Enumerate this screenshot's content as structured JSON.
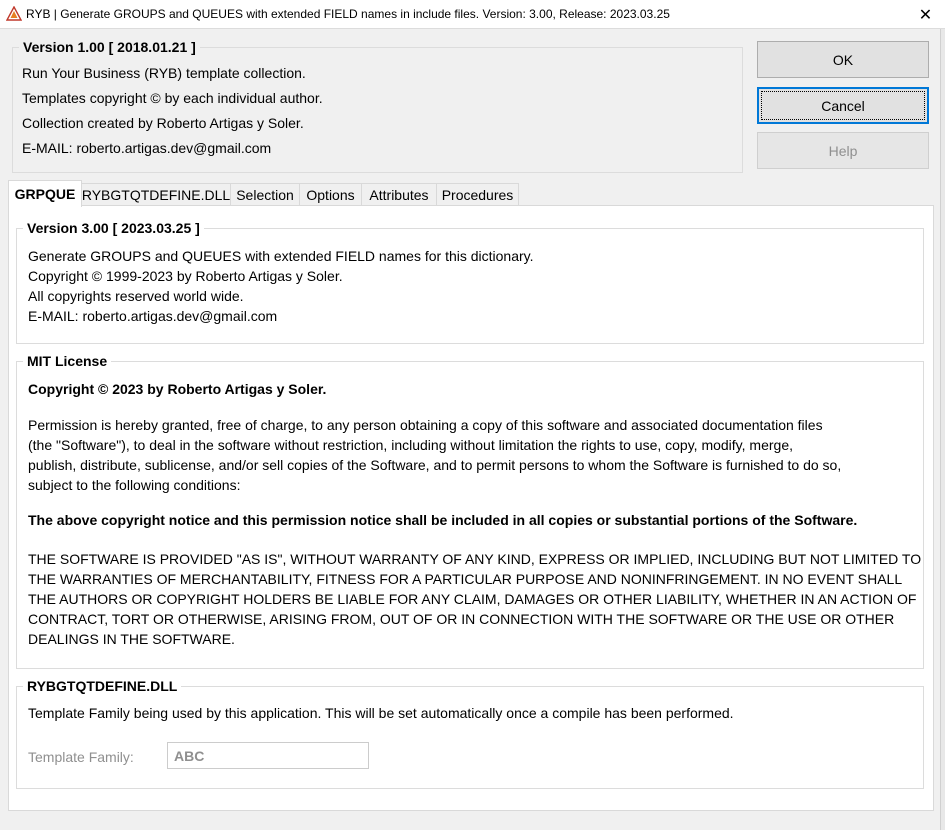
{
  "window": {
    "title": "RYB | Generate GROUPS and QUEUES with extended FIELD names in include files. Version: 3.00, Release: 2023.03.25",
    "icon": "warning-triangle-icon",
    "close_glyph": "✕"
  },
  "header": {
    "group_title": "Version 1.00 [ 2018.01.21 ]",
    "lines": [
      "Run Your Business (RYB) template collection.",
      "Templates copyright © by each individual author.",
      "Collection created by Roberto Artigas y Soler.",
      "E-MAIL: roberto.artigas.dev@gmail.com"
    ]
  },
  "buttons": {
    "ok": "OK",
    "cancel": "Cancel",
    "help": "Help"
  },
  "tabs": [
    {
      "label": "GRPQUE",
      "active": true
    },
    {
      "label": "RYBGTQTDEFINE.DLL",
      "active": false
    },
    {
      "label": "Selection",
      "active": false
    },
    {
      "label": "Options",
      "active": false
    },
    {
      "label": "Attributes",
      "active": false
    },
    {
      "label": "Procedures",
      "active": false
    }
  ],
  "version_group": {
    "title": "Version 3.00 [ 2023.03.25 ]",
    "lines": [
      "Generate GROUPS and QUEUES with extended FIELD names for this dictionary.",
      "Copyright © 1999-2023 by Roberto Artigas y Soler.",
      "All copyrights reserved world wide.",
      "E-MAIL: roberto.artigas.dev@gmail.com"
    ]
  },
  "license_group": {
    "title": "MIT License",
    "copyright": "Copyright © 2023 by Roberto Artigas y Soler.",
    "permission_lines": [
      "Permission is hereby granted, free of charge, to any person obtaining a copy of this software and associated documentation files",
      "(the \"Software\"), to deal in the software without restriction, including without limitation the rights to use, copy, modify, merge,",
      "publish, distribute, sublicense, and/or sell copies of the Software, and to permit persons to whom the Software is furnished to do so,",
      "subject to the following conditions:"
    ],
    "notice": "The above copyright notice and this permission notice shall be included in all copies or substantial portions of the Software.",
    "warranty_lines": [
      "THE SOFTWARE IS PROVIDED \"AS IS\", WITHOUT WARRANTY OF ANY KIND, EXPRESS OR IMPLIED, INCLUDING BUT NOT LIMITED TO",
      "THE WARRANTIES OF MERCHANTABILITY, FITNESS FOR A PARTICULAR PURPOSE AND NONINFRINGEMENT. IN NO EVENT SHALL",
      "THE AUTHORS OR COPYRIGHT HOLDERS BE LIABLE FOR ANY CLAIM, DAMAGES OR OTHER LIABILITY, WHETHER IN AN ACTION OF",
      "CONTRACT, TORT OR OTHERWISE, ARISING FROM, OUT OF OR IN CONNECTION WITH THE SOFTWARE OR THE USE OR OTHER",
      "DEALINGS IN THE SOFTWARE."
    ]
  },
  "dll_group": {
    "title": "RYBGTQTDEFINE.DLL",
    "description": "Template Family being used by this application. This will be set automatically once a compile has been performed.",
    "field_label": "Template Family:",
    "field_value": "ABC"
  },
  "colors": {
    "accent": "#0078d7",
    "disabled_text": "#8f8f8f",
    "dialog_bg": "#f0f0f0"
  }
}
